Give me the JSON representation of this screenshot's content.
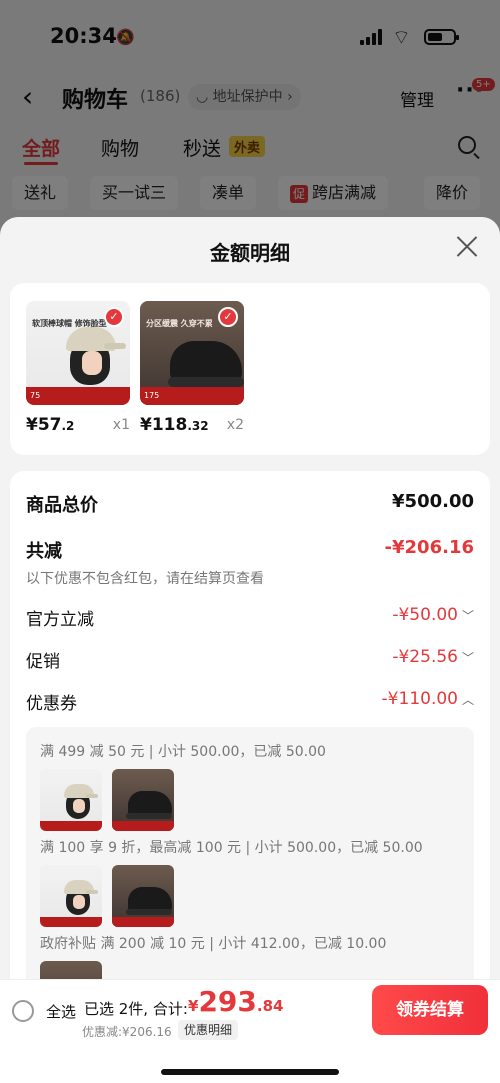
{
  "status": {
    "time": "20:34"
  },
  "nav": {
    "back_icon": "chevron-left-icon",
    "title": "购物车",
    "count": "(186)",
    "address_chip": "地址保护中",
    "manage": "管理",
    "more_badge": "5+"
  },
  "tabs": [
    {
      "label": "全部"
    },
    {
      "label": "购物"
    },
    {
      "label": "秒送"
    }
  ],
  "tab_tag": "外卖",
  "chips": [
    {
      "label": "送礼"
    },
    {
      "label": "买一试三"
    },
    {
      "label": "凑单"
    },
    {
      "tag": "促",
      "label": "跨店满减"
    },
    {
      "label": "降价"
    }
  ],
  "sheet": {
    "title": "金额明细",
    "products": [
      {
        "price_int": "¥57",
        "price_dec": ".2",
        "qty": "x1",
        "thumb_text": "软顶棒球帽 修饰脸型",
        "thumb_price": "75"
      },
      {
        "price_int": "¥118",
        "price_dec": ".32",
        "qty": "x2",
        "thumb_text": "分区缓震 久穿不累",
        "thumb_price": "175"
      }
    ],
    "rows": {
      "total_label": "商品总价",
      "total_value": "¥500.00",
      "discount_label": "共减",
      "discount_value": "-¥206.16",
      "discount_note": "以下优惠不包含红包，请在结算页查看",
      "official_label": "官方立减",
      "official_value": "-¥50.00",
      "promo_label": "促销",
      "promo_value": "-¥25.56",
      "coupon_label": "优惠券",
      "coupon_value": "-¥110.00"
    },
    "coupon_lines": [
      "满 499 减 50 元 | 小计 500.00，已减 50.00",
      "满 100 享 9 折，最高减 100 元 | 小计 500.00，已减 50.00",
      "政府补贴 满 200 减 10 元 | 小计 412.00，已减 10.00"
    ]
  },
  "bottom": {
    "select_all": "全选",
    "selected_info": "已选 2件, 合计:",
    "total_currency": "¥",
    "total_int": "293",
    "total_dec": ".84",
    "discount_info": "优惠减:¥206.16",
    "detail_chip": "优惠明细",
    "checkout": "领券结算"
  },
  "colors": {
    "accent": "#e4393c",
    "checkout": "#f0303a"
  }
}
